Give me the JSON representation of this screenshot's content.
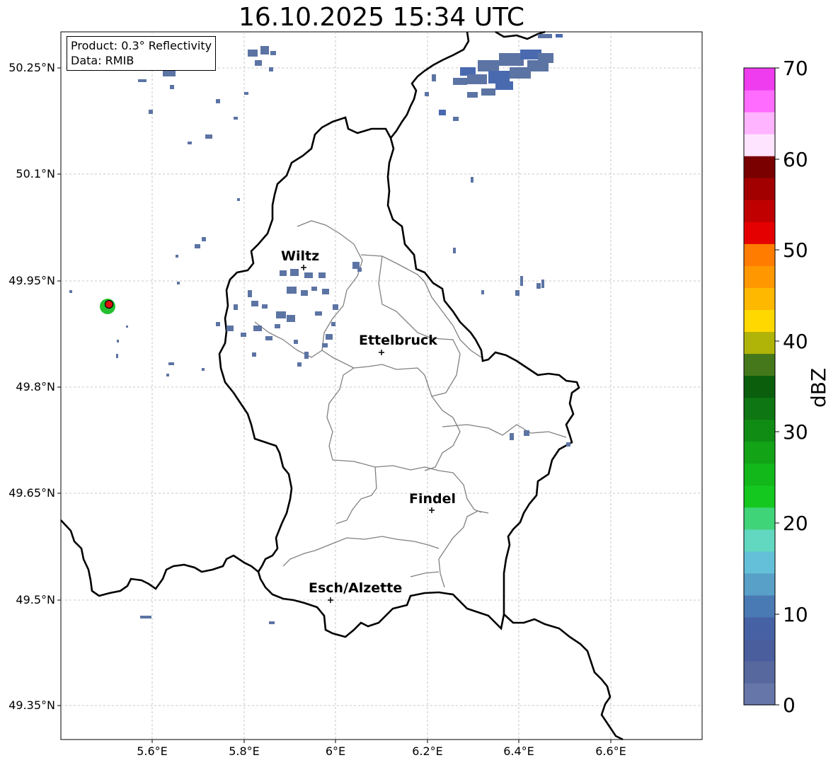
{
  "title": "16.10.2025 15:34 UTC",
  "info": {
    "product": "Product: 0.3° Reflectivity",
    "data": "Data: RMIB"
  },
  "lat_ticks": [
    "50.25°N",
    "50.1°N",
    "49.95°N",
    "49.8°N",
    "49.65°N",
    "49.5°N",
    "49.35°N"
  ],
  "lon_ticks": [
    "5.6°E",
    "5.8°E",
    "6°E",
    "6.2°E",
    "6.4°E",
    "6.6°E"
  ],
  "cities": [
    "Wiltz",
    "Ettelbruck",
    "Findel",
    "Esch/Alzette"
  ],
  "colorbar": {
    "label": "dBZ",
    "ticks": [
      "0",
      "10",
      "20",
      "30",
      "40",
      "50",
      "60",
      "70"
    ],
    "colors": [
      "#6676a8",
      "#56689e",
      "#4a5e9e",
      "#4662a4",
      "#4a7ab4",
      "#58a0c8",
      "#64c0d8",
      "#62d8c0",
      "#40d478",
      "#14c820",
      "#12b81a",
      "#12a416",
      "#108c14",
      "#0e7612",
      "#0a5e0c",
      "#44781a",
      "#b0b408",
      "#ffd800",
      "#ffb800",
      "#ff9800",
      "#ff7c00",
      "#e40000",
      "#c00000",
      "#a20000",
      "#7a0000",
      "#ffe4ff",
      "#ffb4ff",
      "#ff6cff",
      "#ee3cee"
    ]
  },
  "radar_colors": {
    "echo": "#5c74a4",
    "strong_echo": "#4a6ab0",
    "marker_fill": "#22c030",
    "marker_center": "#e01010"
  }
}
